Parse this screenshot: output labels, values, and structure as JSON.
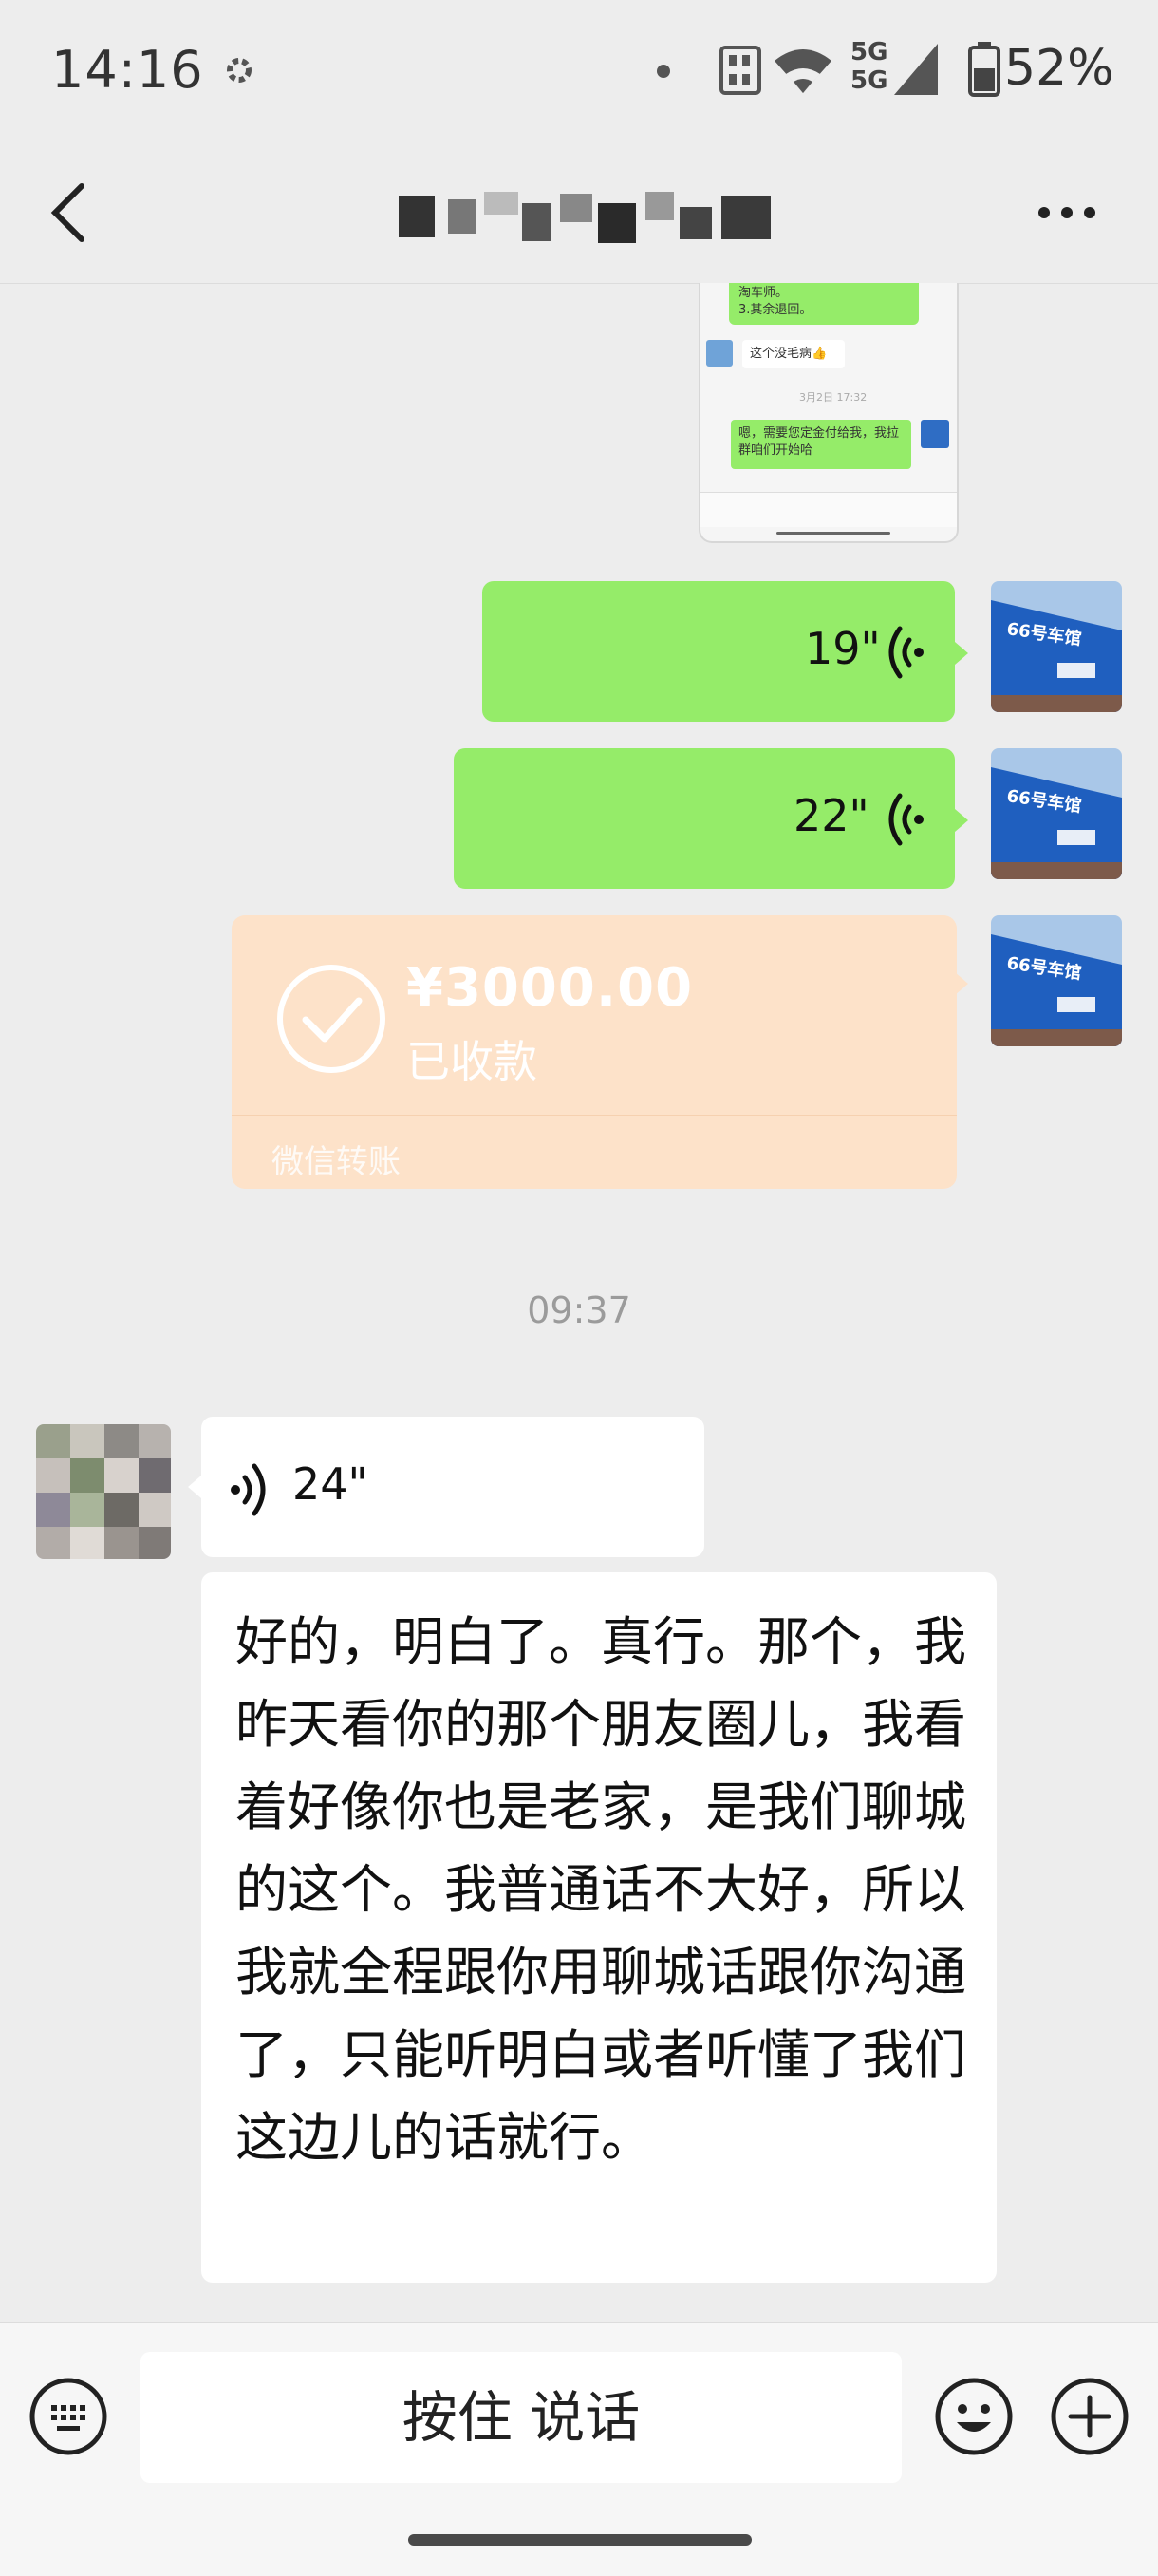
{
  "status_bar": {
    "time": "14:16",
    "network_top": "5G",
    "network_bottom": "5G",
    "battery": "52%"
  },
  "chat": {
    "timestamp": "09:37",
    "messages": [
      {
        "type": "voice",
        "side": "right",
        "duration": "19\""
      },
      {
        "type": "voice",
        "side": "right",
        "duration": "22\""
      },
      {
        "type": "transfer",
        "side": "right",
        "amount": "¥3000.00",
        "status": "已收款",
        "label": "微信转账"
      },
      {
        "type": "voice",
        "side": "left",
        "duration": "24\""
      },
      {
        "type": "text",
        "side": "left",
        "text": "好的，明白了。真行。那个，我昨天看你的那个朋友圈儿，我看着好像你也是老家，是我们聊城的这个。我普通话不大好，所以我就全程跟你用聊城话跟你沟通了，只能听明白或者听懂了我们这边儿的话就行。"
      }
    ]
  },
  "screenshot_thumbnail": {
    "line1": "淘车师。",
    "line2": "3.其余退回。",
    "reply": "这个没毛病👍",
    "time": "3月2日 17:32",
    "msg": "嗯，需要您定金付给我，我拉群咱们开始哈"
  },
  "store_avatar_sign": "66号车馆",
  "input_bar": {
    "talk_label": "按住 说话"
  },
  "colors": {
    "green_bubble": "#95ec69",
    "transfer_bg": "#fde2c9",
    "background": "#ededed"
  }
}
